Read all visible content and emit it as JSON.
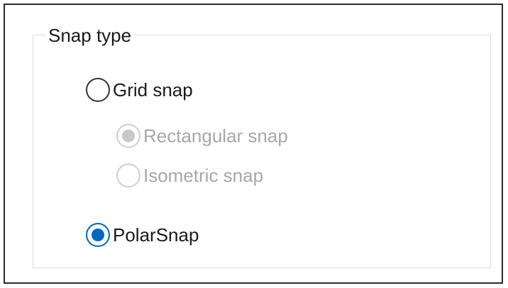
{
  "group": {
    "title": "Snap type"
  },
  "options": [
    {
      "label": "Grid snap",
      "checked": false,
      "enabled": true
    },
    {
      "label": "Rectangular snap",
      "checked": true,
      "enabled": false
    },
    {
      "label": "Isometric snap",
      "checked": false,
      "enabled": false
    },
    {
      "label": "PolarSnap",
      "checked": true,
      "enabled": true
    }
  ]
}
